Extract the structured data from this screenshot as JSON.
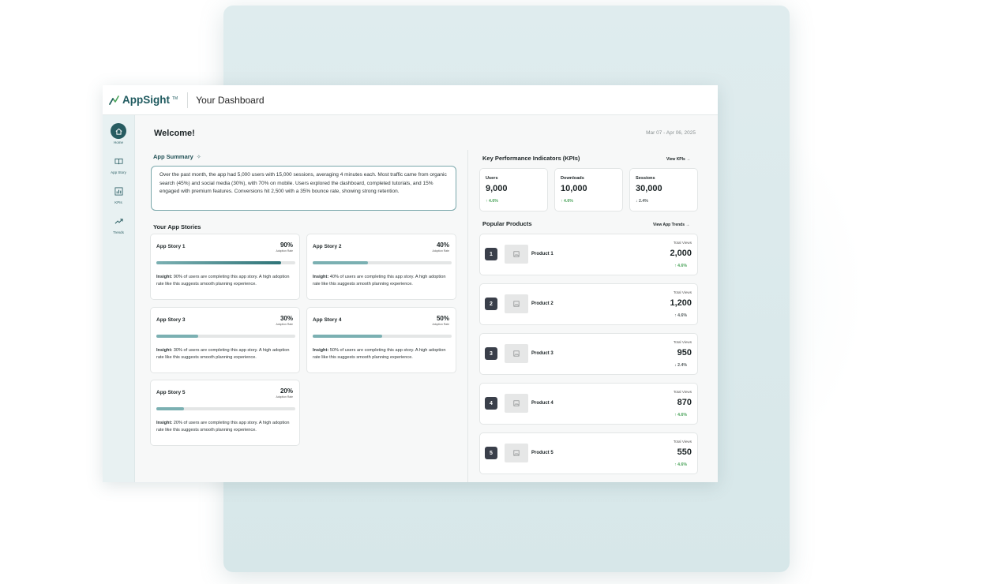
{
  "app": {
    "logo": "AppSight",
    "logo_tm": "TM",
    "title": "Your Dashboard"
  },
  "sidebar": {
    "items": [
      {
        "label": "Home",
        "icon": "home-icon"
      },
      {
        "label": "App Story",
        "icon": "book-icon"
      },
      {
        "label": "KPIs",
        "icon": "bar-chart-icon"
      },
      {
        "label": "Trends",
        "icon": "trend-icon"
      }
    ]
  },
  "header": {
    "welcome": "Welcome!",
    "date_range": "Mar 07 - Apr 06, 2025"
  },
  "summary": {
    "title": "App Summary",
    "text": "Over the past month, the app had 5,000 users with 15,000 sessions, averaging 4 minutes each. Most traffic came from organic search (45%) and social media (30%), with 70% on mobile. Users explored the dashboard, completed tutorials, and 15% engaged with premium features. Conversions hit 2,500 with a 35% bounce rate, showing strong retention."
  },
  "stories": {
    "title": "Your App Stories",
    "insight_label": "Insight:",
    "items": [
      {
        "name": "App Story 1",
        "pct": "90%",
        "pct_label": "Adoption Rate",
        "fill": 0.9,
        "insight": "90% of users are completing this app story. A high adoption rate like this suggests smooth planning experience."
      },
      {
        "name": "App Story 2",
        "pct": "40%",
        "pct_label": "Adoption Rate",
        "fill": 0.4,
        "insight": "40% of users are completing this app story. A high adoption rate like this suggests smooth planning experience."
      },
      {
        "name": "App Story 3",
        "pct": "30%",
        "pct_label": "Adoption Rate",
        "fill": 0.3,
        "insight": "30% of users are completing this app story. A high adoption rate like this suggests smooth planning experience."
      },
      {
        "name": "App Story 4",
        "pct": "50%",
        "pct_label": "Adoption Rate",
        "fill": 0.5,
        "insight": "50% of users are completing this app story. A high adoption rate like this suggests smooth planning experience."
      },
      {
        "name": "App Story 5",
        "pct": "20%",
        "pct_label": "Adoption Rate",
        "fill": 0.2,
        "insight": "20% of users are completing this app story. A high adoption rate like this suggests smooth planning experience."
      }
    ]
  },
  "kpis": {
    "title": "Key Performance Indicators (KPIs)",
    "view_link": "View KPIs →",
    "items": [
      {
        "label": "Users",
        "value": "9,000",
        "delta": "↑ 4.6%",
        "trend": "up"
      },
      {
        "label": "Downloads",
        "value": "10,000",
        "delta": "↑ 4.6%",
        "trend": "up"
      },
      {
        "label": "Sessions",
        "value": "30,000",
        "delta": "↓ 2.4%",
        "trend": "down"
      }
    ]
  },
  "products": {
    "title": "Popular Products",
    "view_link": "View App Trends →",
    "tv_label": "Total Views",
    "items": [
      {
        "rank": "1",
        "name": "Product 1",
        "value": "2,000",
        "delta": "↑ 4.6%",
        "trend": "up"
      },
      {
        "rank": "2",
        "name": "Product 2",
        "value": "1,200",
        "delta": "↑ 4.6%",
        "trend": "down"
      },
      {
        "rank": "3",
        "name": "Product 3",
        "value": "950",
        "delta": "↓ 2.4%",
        "trend": "down"
      },
      {
        "rank": "4",
        "name": "Product 4",
        "value": "870",
        "delta": "↑ 4.6%",
        "trend": "up"
      },
      {
        "rank": "5",
        "name": "Product 5",
        "value": "550",
        "delta": "↑ 4.6%",
        "trend": "up"
      }
    ]
  },
  "colors": {
    "brand": "#1f5a5f",
    "active_nav": "#275c61",
    "bar_fill": "#7bb0b2",
    "bar_fill_strong": "#2f7478",
    "up": "#4aa35a",
    "rank_badge": "#3a3f4a"
  }
}
